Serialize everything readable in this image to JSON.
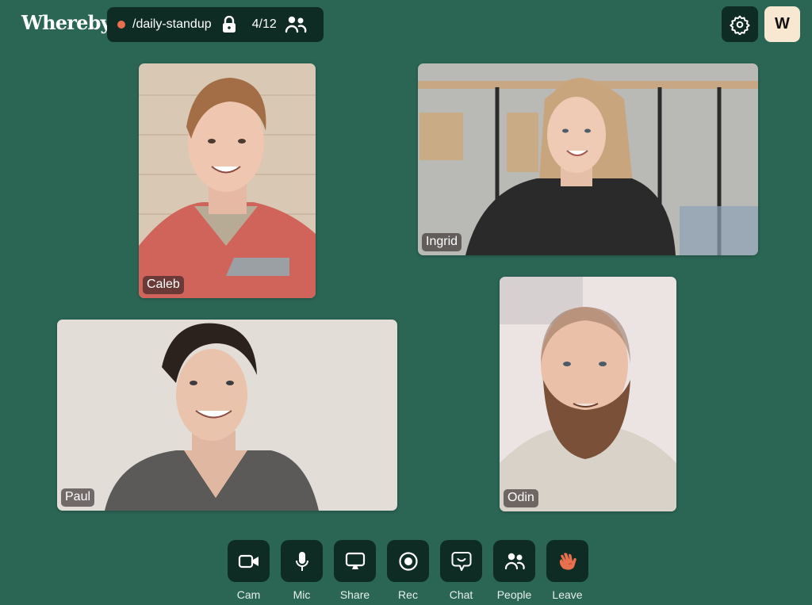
{
  "header": {
    "logo": "Whereby",
    "room_name": "/daily-standup",
    "locked": true,
    "participant_count": "4/12",
    "recording_dot_color": "#e8704f",
    "avatar_initial": "W"
  },
  "participants": [
    {
      "name": "Caleb",
      "shirt_color": "#d0635a",
      "bg_color": "#d8c8b4"
    },
    {
      "name": "Ingrid",
      "shirt_color": "#2a2a2a",
      "bg_color": "#b9b9b6"
    },
    {
      "name": "Paul",
      "shirt_color": "#5c5a58",
      "bg_color": "#e2ddd7"
    },
    {
      "name": "Odin",
      "shirt_color": "#d8d2c8",
      "bg_color": "#ece4e2"
    }
  ],
  "toolbar": {
    "items": [
      {
        "label": "Cam",
        "icon": "camera-icon"
      },
      {
        "label": "Mic",
        "icon": "microphone-icon"
      },
      {
        "label": "Share",
        "icon": "screen-share-icon"
      },
      {
        "label": "Rec",
        "icon": "record-icon"
      },
      {
        "label": "Chat",
        "icon": "chat-icon"
      },
      {
        "label": "People",
        "icon": "people-icon"
      },
      {
        "label": "Leave",
        "icon": "waving-hand-icon"
      }
    ],
    "leave_color": "#e8704f"
  },
  "colors": {
    "background": "#2b6655",
    "panel": "#0f2c24",
    "avatar_bg": "#f8e8d2"
  }
}
